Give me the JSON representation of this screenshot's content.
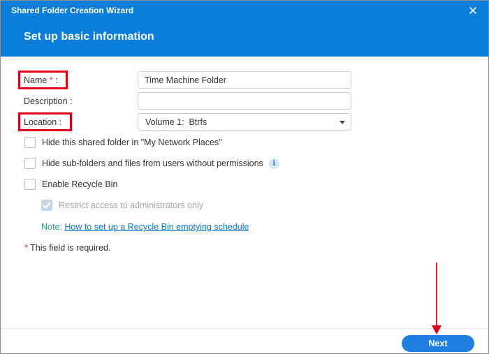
{
  "window": {
    "title": "Shared Folder Creation Wizard",
    "heading": "Set up basic information"
  },
  "form": {
    "name_label": "Name",
    "name_required_mark": "*",
    "name_colon": " :",
    "name_value": "Time Machine Folder",
    "description_label": "Description :",
    "description_value": "",
    "location_label": "Location :",
    "location_value": "Volume 1:  Btrfs"
  },
  "options": {
    "hide_folder_label": "Hide this shared folder in \"My Network Places\"",
    "hide_subfolders_label": "Hide sub-folders and files from users without permissions",
    "info_icon_glyph": "i",
    "recycle_bin_label": "Enable Recycle Bin",
    "restrict_admin_label": "Restrict access to administrators only",
    "restrict_admin_checked": true
  },
  "note": {
    "prefix": "Note: ",
    "link_text": "How to set up a Recycle Bin emptying schedule"
  },
  "required_note": {
    "mark": "*",
    "text": " This field is required."
  },
  "footer": {
    "next_label": "Next"
  },
  "colors": {
    "header_blue": "#0b7ddb",
    "annotation_red": "#e0001a",
    "button_blue": "#1f7fe0",
    "note_green": "#2aa37e"
  }
}
